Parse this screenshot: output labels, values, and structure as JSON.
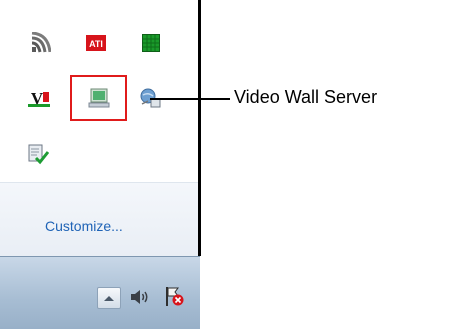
{
  "tray_panel": {
    "icons": [
      {
        "name": "wireless-signal-icon"
      },
      {
        "name": "ati-icon",
        "text": "ATI"
      },
      {
        "name": "green-grid-icon"
      },
      {
        "name": "vmware-icon",
        "text": "V"
      },
      {
        "name": "video-wall-server-icon"
      },
      {
        "name": "network-globe-icon"
      },
      {
        "name": "document-check-icon"
      }
    ],
    "customize_label": "Customize..."
  },
  "callout": {
    "label": "Video Wall Server",
    "highlight_color": "#e01b1b"
  },
  "taskbar": {
    "icons": [
      {
        "name": "show-hidden-icons-button"
      },
      {
        "name": "speaker-icon"
      },
      {
        "name": "action-center-flag-icon"
      }
    ]
  },
  "colors": {
    "link": "#1f63b6",
    "ati_red": "#d7141b",
    "grid_green": "#1a9a2a"
  }
}
